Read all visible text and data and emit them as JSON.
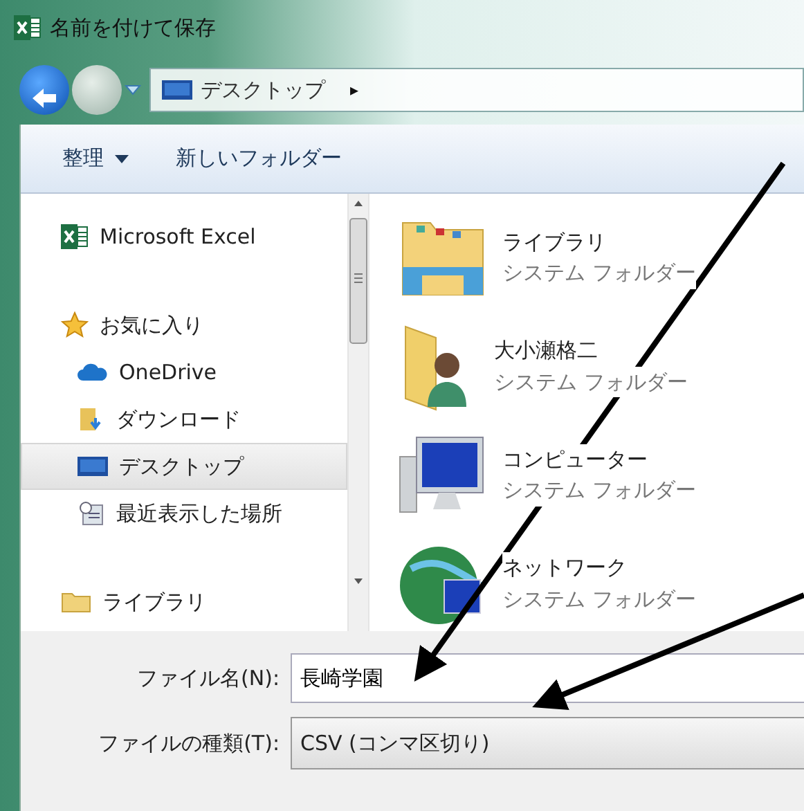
{
  "window": {
    "title": "名前を付けて保存"
  },
  "address_bar": {
    "path": [
      {
        "label": "デスクトップ"
      }
    ],
    "separator": "▸"
  },
  "toolbar": [
    {
      "label": "整理",
      "dropdown": true
    },
    {
      "label": "新しいフォルダー",
      "dropdown": false
    }
  ],
  "sidebar": {
    "items": [
      {
        "label": "Microsoft Excel",
        "kind": "excel",
        "selected": false
      },
      {
        "label": "お気に入り",
        "kind": "star",
        "selected": false,
        "children": [
          {
            "label": "OneDrive",
            "kind": "cloud",
            "selected": false
          },
          {
            "label": "ダウンロード",
            "kind": "download",
            "selected": false
          },
          {
            "label": "デスクトップ",
            "kind": "desktop",
            "selected": true
          },
          {
            "label": "最近表示した場所",
            "kind": "recent",
            "selected": false
          }
        ]
      },
      {
        "label": "ライブラリ",
        "kind": "library",
        "selected": false
      }
    ]
  },
  "items": [
    {
      "name": "ライブラリ",
      "subtitle": "システム フォルダー",
      "kind": "library"
    },
    {
      "name": "大小瀬格二",
      "subtitle": "システム フォルダー",
      "kind": "user"
    },
    {
      "name": "コンピューター",
      "subtitle": "システム フォルダー",
      "kind": "computer"
    },
    {
      "name": "ネットワーク",
      "subtitle": "システム フォルダー",
      "kind": "network"
    }
  ],
  "file_name": {
    "label": "ファイル名(N):",
    "value": "長崎学園"
  },
  "file_type": {
    "label": "ファイルの種類(T):",
    "value": "CSV (コンマ区切り)"
  }
}
